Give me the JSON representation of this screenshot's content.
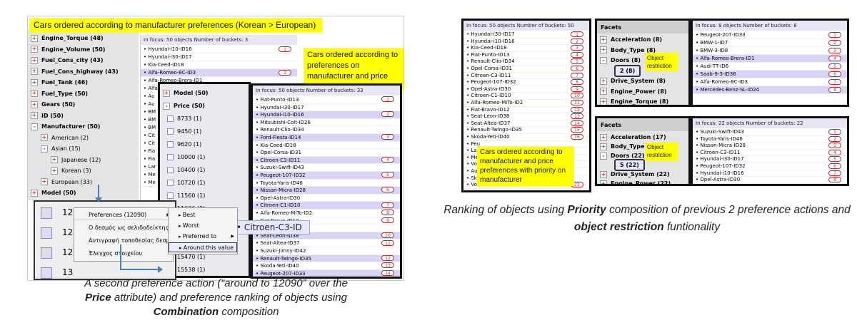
{
  "colors": {
    "callout": "#ffff00",
    "highlight": "#d7d4f5",
    "rank": "#b03030",
    "arrow": "#4a7cc0"
  },
  "left_shot": {
    "title_callout": "Cars ordered according to manufacturer preferences (Korean > European)",
    "facets": [
      {
        "label": "Engine_Torque  (48)",
        "sign": "+",
        "indent": 0,
        "bold": true
      },
      {
        "label": "Engine_Volume  (50)",
        "sign": "+",
        "indent": 0,
        "bold": true
      },
      {
        "label": "Fuel_Cons_city  (43)",
        "sign": "+",
        "indent": 0,
        "bold": true
      },
      {
        "label": "Fuel_Cons_highway  (43)",
        "sign": "+",
        "indent": 0,
        "bold": true
      },
      {
        "label": "Fuel_Tank  (46)",
        "sign": "+",
        "indent": 0,
        "bold": true
      },
      {
        "label": "Fuel_Type  (50)",
        "sign": "+",
        "indent": 0,
        "bold": true
      },
      {
        "label": "Gears  (50)",
        "sign": "+",
        "indent": 0,
        "bold": true
      },
      {
        "label": "ID  (50)",
        "sign": "+",
        "indent": 0,
        "bold": true
      },
      {
        "label": "Manufacturer  (50)",
        "sign": "-",
        "indent": 0,
        "bold": true
      },
      {
        "label": "American  (2)",
        "sign": "+",
        "indent": 1,
        "bold": false
      },
      {
        "label": "Asian  (15)",
        "sign": "-",
        "indent": 1,
        "bold": false
      },
      {
        "label": "Japanese  (12)",
        "sign": "+",
        "indent": 2,
        "bold": false
      },
      {
        "label": "Korean  (3)",
        "sign": "+",
        "indent": 2,
        "bold": false
      },
      {
        "label": "European  (33)",
        "sign": "+",
        "indent": 1,
        "bold": false
      },
      {
        "label": "Model  (50)",
        "sign": "+",
        "indent": 0,
        "bold": true
      }
    ],
    "focus_header": "In focus: 50 objects     Number of buckets: 3",
    "objects": [
      {
        "name": "Hyundai-i10-ID16",
        "rank": "1",
        "hl": false
      },
      {
        "name": "Hyundai-i30-ID17",
        "rank": "",
        "hl": false
      },
      {
        "name": "Kia-Ceed-ID18",
        "rank": "",
        "hl": false
      },
      {
        "name": "Alfa-Romeo-8C-ID3",
        "rank": "2",
        "hl": true
      },
      {
        "name": "Alfa-Romeo-Brera-ID1",
        "rank": "",
        "hl": false
      },
      {
        "name": "Alfa",
        "rank": "",
        "hl": false
      },
      {
        "name": "Au",
        "rank": "",
        "hl": false
      },
      {
        "name": "Au",
        "rank": "",
        "hl": false
      },
      {
        "name": "BM",
        "rank": "",
        "hl": false
      },
      {
        "name": "BM",
        "rank": "",
        "hl": false
      },
      {
        "name": "BM",
        "rank": "",
        "hl": false
      },
      {
        "name": "Cit",
        "rank": "",
        "hl": false
      },
      {
        "name": "Cit",
        "rank": "",
        "hl": false
      },
      {
        "name": "Fia",
        "rank": "",
        "hl": false
      },
      {
        "name": "Fia",
        "rank": "",
        "hl": false
      },
      {
        "name": "Lar",
        "rank": "",
        "hl": false
      },
      {
        "name": "Me",
        "rank": "",
        "hl": false
      },
      {
        "name": "Me",
        "rank": "",
        "hl": false
      }
    ],
    "price_callout": "Cars ordered according to preferences on manufacturer and price",
    "price_facets": [
      {
        "label": "Model  (50)",
        "type": "sign",
        "sign": "+",
        "bold": true
      },
      {
        "label": "Price  (50)",
        "type": "sign",
        "sign": "-",
        "bold": true
      },
      {
        "label": "8733  (1)",
        "type": "check"
      },
      {
        "label": "9450  (1)",
        "type": "check"
      },
      {
        "label": "9620  (1)",
        "type": "check"
      },
      {
        "label": "10000  (1)",
        "type": "check"
      },
      {
        "label": "10400  (1)",
        "type": "check"
      },
      {
        "label": "10720  (1)",
        "type": "check"
      },
      {
        "label": "11560  (1)",
        "type": "check"
      },
      {
        "label": "11636  (1)",
        "type": "check"
      },
      {
        "label": "11683  (1)",
        "type": "check"
      },
      {
        "label": "12090  (1)",
        "type": "check"
      }
    ],
    "price_lower_values": [
      "15470  (1)",
      "15538  (1)"
    ],
    "price_focus_header": "In focus: 50 objects     Number of buckets: 33",
    "price_objects": [
      {
        "name": "Fiat-Punto-ID13",
        "rank": "1",
        "hl": false
      },
      {
        "name": "Hyundai-i30-ID17",
        "rank": "",
        "hl": false
      },
      {
        "name": "Hyundai-i10-ID16",
        "rank": "2",
        "hl": true
      },
      {
        "name": "Mitsubishi-Colt-ID26",
        "rank": "",
        "hl": false
      },
      {
        "name": "Renault-Clio-ID34",
        "rank": "",
        "hl": false
      },
      {
        "name": "Ford-Fiesta-ID14",
        "rank": "3",
        "hl": true
      },
      {
        "name": "Kia-Ceed-ID18",
        "rank": "",
        "hl": false
      },
      {
        "name": "Opel-Corsa-ID31",
        "rank": "",
        "hl": false
      },
      {
        "name": "Citroen-C3-ID11",
        "rank": "4",
        "hl": true
      },
      {
        "name": "Suzuki-Swift-ID43",
        "rank": "",
        "hl": false
      },
      {
        "name": "Peugeot-107-ID32",
        "rank": "5",
        "hl": true
      },
      {
        "name": "Toyota-Yaris-ID46",
        "rank": "",
        "hl": false
      },
      {
        "name": "Nissan-Micra-ID28",
        "rank": "6",
        "hl": true
      },
      {
        "name": "Opel-Astra-ID30",
        "rank": "",
        "hl": false
      },
      {
        "name": "Citroen-C1-ID10",
        "rank": "7",
        "hl": true
      },
      {
        "name": "Alfa-Romeo-MiTo-ID2",
        "rank": "8",
        "hl": false
      },
      {
        "name": "Fiat-Bravo-ID12",
        "rank": "9",
        "hl": false
      },
      {
        "name": "Ford-Ka-ID15",
        "rank": "",
        "hl": false
      },
      {
        "name": "Seat-Leon-ID38",
        "rank": "10",
        "hl": true
      },
      {
        "name": "Seat-Altea-ID37",
        "rank": "11",
        "hl": false
      },
      {
        "name": "Suzuki-Jimny-ID42",
        "rank": "",
        "hl": false
      },
      {
        "name": "Renault-Twingo-ID35",
        "rank": "12",
        "hl": true
      },
      {
        "name": "Skoda-Yeti-ID40",
        "rank": "13",
        "hl": false
      },
      {
        "name": "Peugeot-207-ID33",
        "rank": "14",
        "hl": true
      }
    ],
    "zoom_label": "Citroen-C3-ID",
    "context_rows": [
      "12090  (1)",
      "12",
      "129",
      "13"
    ],
    "context_menu": {
      "items": [
        "Preferences (12090)",
        "Ο δεσμός ως σελιδοδείκτης",
        "Αντιγραφή τοποθεσίας δεσμού",
        "Έλεγχος στοιχείου"
      ],
      "submenu": [
        "Best",
        "Worst",
        "Preferred to",
        "Around this value"
      ]
    },
    "caption_plain_1": "A second preference action (“around to 12090” over the",
    "caption_bold_1": "Price",
    "caption_plain_2": " attribute) and preference ranking of objects using",
    "caption_bold_2": "Combination",
    "caption_plain_3": " composition"
  },
  "right_shot": {
    "list_header": "In focus: 50 objects     Number of buckets: 50",
    "list": [
      {
        "name": "Hyundai-i30-ID17",
        "rank": "1"
      },
      {
        "name": "Hyundai-i10-ID16",
        "rank": "2"
      },
      {
        "name": "Kia-Ceed-ID18",
        "rank": "3"
      },
      {
        "name": "Fiat-Punto-ID13",
        "rank": "4"
      },
      {
        "name": "Renault-Clio-ID34",
        "rank": "5"
      },
      {
        "name": "Opel-Corsa-ID31",
        "rank": "6"
      },
      {
        "name": "Citroen-C3-ID11",
        "rank": "7"
      },
      {
        "name": "Peugeot-107-ID32",
        "rank": "8"
      },
      {
        "name": "Opel-Astra-ID30",
        "rank": "9"
      },
      {
        "name": "Citroen-C1-ID10",
        "rank": "10"
      },
      {
        "name": "Alfa-Romeo-MiTo-ID2",
        "rank": "11"
      },
      {
        "name": "Fiat-Bravo-ID12",
        "rank": "12"
      },
      {
        "name": "Seat-Leon-ID38",
        "rank": "13"
      },
      {
        "name": "Seat-Altea-ID37",
        "rank": "14"
      },
      {
        "name": "Renault-Twingo-ID35",
        "rank": "15"
      },
      {
        "name": "Skoda-Yeti-ID40",
        "rank": "16"
      },
      {
        "name": "Peu",
        "rank": ""
      },
      {
        "name": "Lan",
        "rank": ""
      },
      {
        "name": "Mer",
        "rank": ""
      },
      {
        "name": "Volk",
        "rank": ""
      },
      {
        "name": "Aud",
        "rank": ""
      },
      {
        "name": "Sko",
        "rank": ""
      },
      {
        "name": "Volvo-C30-ID50",
        "rank": "23"
      }
    ],
    "priority_callout": "Cars ordered according to manufacturer and price preferences with priority on manufacturer",
    "top_facets_title": "Facets",
    "top_facets": [
      {
        "label": "Acceleration  (8)",
        "sign": "+",
        "indent": 0
      },
      {
        "label": "Body_Type  (8)",
        "sign": "+",
        "indent": 0
      },
      {
        "label": "Doors  (8)",
        "sign": "-",
        "indent": 0
      },
      {
        "label": "2  (8)",
        "sign": "",
        "indent": 1
      },
      {
        "label": "Drive_System  (8)",
        "sign": "+",
        "indent": 0
      },
      {
        "label": "Engine_Power  (8)",
        "sign": "+",
        "indent": 0
      },
      {
        "label": "Engine_Torque  (8)",
        "sign": "+",
        "indent": 0
      }
    ],
    "top_restriction": "Object restriction",
    "top_header": "In focus: 8 objects     Number of buckets: 8",
    "top_objects": [
      {
        "name": "Peugeot-207-ID33",
        "rank": "1",
        "hl": false
      },
      {
        "name": "BMW-1-ID7",
        "rank": "2",
        "hl": false
      },
      {
        "name": "BMW-3-ID8",
        "rank": "3",
        "hl": false
      },
      {
        "name": "Alfa-Romeo-Brera-ID1",
        "rank": "4",
        "hl": true
      },
      {
        "name": "Audi-TT-ID6",
        "rank": "5",
        "hl": false
      },
      {
        "name": "Saab-9-3-ID36",
        "rank": "6",
        "hl": true
      },
      {
        "name": "Alfa-Romeo-8C-ID3",
        "rank": "7",
        "hl": false
      },
      {
        "name": "Mercedes-Benz-SL-ID24",
        "rank": "8",
        "hl": true
      }
    ],
    "bottom_facets_title": "Facets",
    "bottom_facets": [
      {
        "label": "Acceleration  (17)",
        "sign": "+",
        "indent": 0
      },
      {
        "label": "Body_Type  (22)",
        "sign": "+",
        "indent": 0
      },
      {
        "label": "Doors  (22)",
        "sign": "-",
        "indent": 0
      },
      {
        "label": "5  (22)",
        "sign": "",
        "indent": 1
      },
      {
        "label": "Drive_System  (22)",
        "sign": "+",
        "indent": 0
      },
      {
        "label": "Engine_Power  (22)",
        "sign": "+",
        "indent": 0
      }
    ],
    "bottom_restriction": "Object restriction",
    "bottom_header": "In focus: 22 objects     Number of buckets: 22",
    "bottom_objects": [
      {
        "name": "Suzuki-Swift-ID43",
        "rank": "1"
      },
      {
        "name": "Toyota-Yaris-ID46",
        "rank": "2"
      },
      {
        "name": "Nissan-Micra-ID28",
        "rank": "3"
      },
      {
        "name": "Citroen-C3-ID11",
        "rank": "4"
      },
      {
        "name": "Hyundai-i30-ID17",
        "rank": "5"
      },
      {
        "name": "Peugeot-107-ID32",
        "rank": "6"
      },
      {
        "name": "Hyundai-i10-ID16",
        "rank": "7"
      },
      {
        "name": "Opel-Astra-ID30",
        "rank": "8"
      }
    ],
    "caption_plain_1": "Ranking of objects using ",
    "caption_bold_1": "Priority",
    "caption_plain_2": " composition of previous 2 preference actions and ",
    "caption_bold_2": "object restriction",
    "caption_plain_3": " funtionality"
  }
}
